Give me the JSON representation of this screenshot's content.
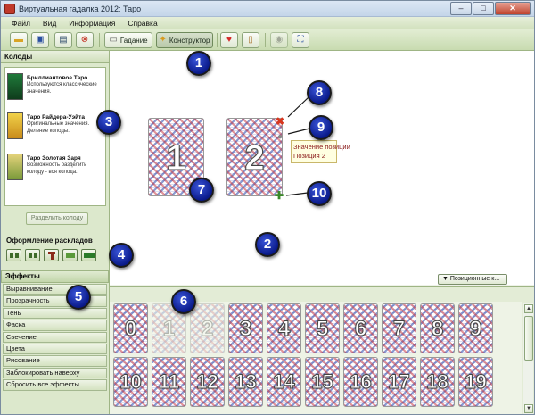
{
  "window": {
    "title": "Виртуальная гадалка 2012: Таро",
    "min_glyph": "–",
    "max_glyph": "□",
    "close_glyph": "✕"
  },
  "menu": [
    "Файл",
    "Вид",
    "Информация",
    "Справка"
  ],
  "toolbar": {
    "divination_label": "Гадание",
    "constructor_label": "Конструктор"
  },
  "decks_panel": {
    "title": "Колоды",
    "decks": [
      {
        "name": "Бриллиантовое Таро",
        "desc": "Используются классические значения."
      },
      {
        "name": "Таро Райдера-Уэйта",
        "desc": "Оригинальные значения. Деление колоды."
      },
      {
        "name": "Таро Золотая Заря",
        "desc": "Возможность разделить колоду - вся колода."
      }
    ],
    "split_button": "Разделить колоду"
  },
  "layout_design": {
    "title": "Оформление раскладов"
  },
  "effects": {
    "title": "Эффекты",
    "items": [
      "Выравнивание",
      "Прозрачность",
      "Тень",
      "Фаска",
      "Свечение",
      "Цвета",
      "Рисование",
      "Заблокировать наверху",
      "Сбросить все эффекты"
    ]
  },
  "canvas": {
    "positions_button": "▼ Позиционные к...",
    "placed_cards": [
      "1",
      "2"
    ],
    "tooltip_line1": "Значение позиции",
    "tooltip_line2": "Позиция 2"
  },
  "strip": {
    "row1": [
      "0",
      "1",
      "2",
      "3",
      "4",
      "5",
      "6",
      "7",
      "8",
      "9"
    ],
    "row2": [
      "10",
      "11",
      "12",
      "13",
      "14",
      "15",
      "16",
      "17",
      "18",
      "19"
    ],
    "faded_cards": [
      "1",
      "2"
    ]
  },
  "callouts": [
    "1",
    "2",
    "3",
    "4",
    "5",
    "6",
    "7",
    "8",
    "9",
    "10"
  ],
  "colors": {
    "callout": "#0a1a8a",
    "toolbar_green": "#c8dbb0",
    "delete_marker": "#d9361e",
    "add_marker": "#3a8a2a"
  }
}
